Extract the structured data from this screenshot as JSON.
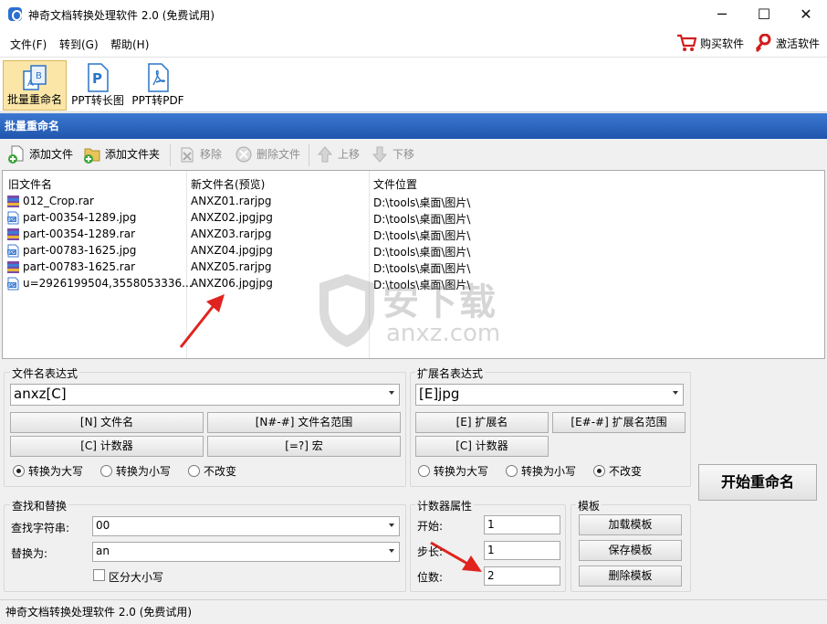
{
  "window": {
    "title": "神奇文档转换处理软件 2.0 (免费试用)",
    "minimize": "─",
    "maximize": "☐",
    "close": "✕"
  },
  "menu": {
    "file": "文件(F)",
    "goto": "转到(G)",
    "help": "帮助(H)"
  },
  "topright": {
    "buy": "购买软件",
    "activate": "激活软件"
  },
  "toolbar": {
    "items": [
      {
        "label": "批量重命名",
        "icon": "batch-rename-icon"
      },
      {
        "label": "PPT转长图",
        "icon": "ppt-icon"
      },
      {
        "label": "PPT转PDF",
        "icon": "pdf-icon"
      }
    ]
  },
  "section_title": "批量重命名",
  "subtoolbar": {
    "add_file": "添加文件",
    "add_folder": "添加文件夹",
    "remove": "移除",
    "delete_file": "删除文件",
    "move_up": "上移",
    "move_down": "下移"
  },
  "filelist": {
    "headers": {
      "old": "旧文件名",
      "new": "新文件名(预览)",
      "path": "文件位置"
    },
    "rows": [
      {
        "old": "012_Crop.rar",
        "new": "ANXZ01.rarjpg",
        "path": "D:\\tools\\桌面\\图片\\",
        "type": "rar"
      },
      {
        "old": "part-00354-1289.jpg",
        "new": "ANXZ02.jpgjpg",
        "path": "D:\\tools\\桌面\\图片\\",
        "type": "jpg"
      },
      {
        "old": "part-00354-1289.rar",
        "new": "ANXZ03.rarjpg",
        "path": "D:\\tools\\桌面\\图片\\",
        "type": "rar"
      },
      {
        "old": "part-00783-1625.jpg",
        "new": "ANXZ04.jpgjpg",
        "path": "D:\\tools\\桌面\\图片\\",
        "type": "jpg"
      },
      {
        "old": "part-00783-1625.rar",
        "new": "ANXZ05.rarjpg",
        "path": "D:\\tools\\桌面\\图片\\",
        "type": "rar"
      },
      {
        "old": "u=2926199504,3558053336...",
        "new": "ANXZ06.jpgjpg",
        "path": "D:\\tools\\桌面\\图片\\",
        "type": "jpg"
      }
    ]
  },
  "watermark": {
    "cn": "安下载",
    "en": "anxz.com"
  },
  "filename_expr": {
    "label": "文件名表达式",
    "value": "anxz[C]",
    "btn_name": "[N] 文件名",
    "btn_range": "[N#-#] 文件名范围",
    "btn_counter": "[C] 计数器",
    "btn_macro": "[=?] 宏",
    "radio_upper": "转换为大写",
    "radio_lower": "转换为小写",
    "radio_keep": "不改变",
    "selected": "upper"
  },
  "ext_expr": {
    "label": "扩展名表达式",
    "value": "[E]jpg",
    "btn_ext": "[E] 扩展名",
    "btn_range": "[E#-#] 扩展名范围",
    "btn_counter": "[C] 计数器",
    "radio_upper": "转换为大写",
    "radio_lower": "转换为小写",
    "radio_keep": "不改变",
    "selected": "keep"
  },
  "start_button": "开始重命名",
  "find_replace": {
    "label": "查找和替换",
    "find_label": "查找字符串:",
    "find_value": "00",
    "replace_label": "替换为:",
    "replace_value": "an",
    "case_label": "区分大小写"
  },
  "counter": {
    "label": "计数器属性",
    "start_label": "开始:",
    "start": "1",
    "step_label": "步长:",
    "step": "1",
    "digits_label": "位数:",
    "digits": "2"
  },
  "template": {
    "label": "模板",
    "load": "加载模板",
    "save": "保存模板",
    "delete": "删除模板"
  },
  "status": "神奇文档转换处理软件 2.0 (免费试用)"
}
